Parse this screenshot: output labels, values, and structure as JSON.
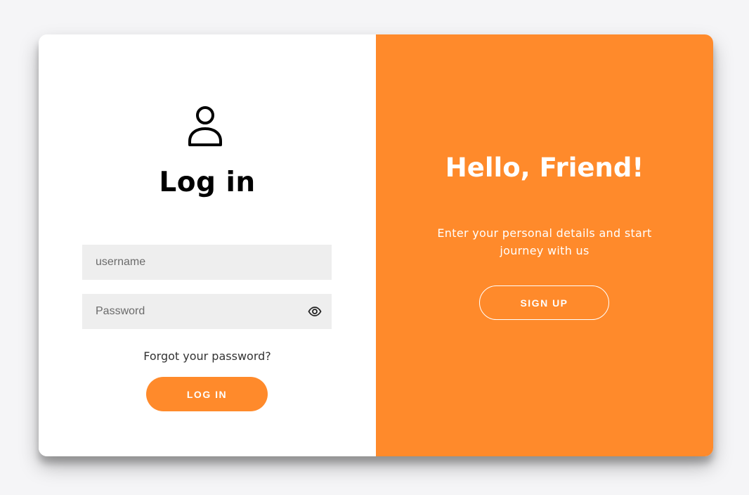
{
  "login": {
    "title": "Log in",
    "username_placeholder": "username",
    "password_placeholder": "Password",
    "forgot_link": "Forgot your password?",
    "login_button": "LOG IN"
  },
  "signup_panel": {
    "title": "Hello, Friend!",
    "text": "Enter your personal details and start journey with us",
    "signup_button": "SIGN UP"
  },
  "icons": {
    "user": "user-icon",
    "password_visibility": "eye-icon"
  },
  "colors": {
    "accent": "#ff8a2b",
    "background": "#f5f5f7",
    "input_background": "#eeeeee"
  }
}
